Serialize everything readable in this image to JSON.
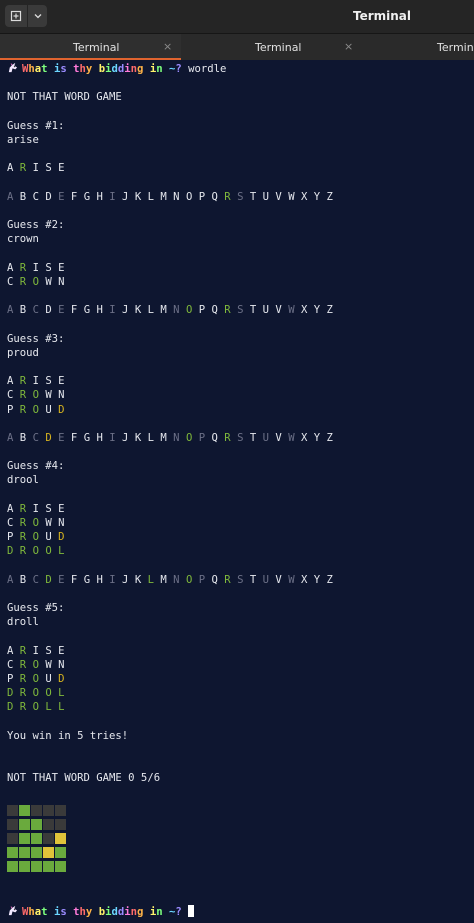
{
  "window": {
    "title": "Terminal",
    "new_tab_icon": "new-tab-icon",
    "menu_icon": "chevron-down-icon"
  },
  "tabs": [
    {
      "label": "Terminal",
      "close": "×",
      "active": true
    },
    {
      "label": "Terminal",
      "close": "×",
      "active": false
    },
    {
      "label": "Terminal",
      "close": "",
      "active": false
    }
  ],
  "prompt": {
    "text": "What is thy bidding in ~?",
    "icon": "unicorn-icon",
    "colors": [
      "#ff6b6b",
      "#ffb347",
      "#fff36b",
      "#7dff7d",
      "#6bd6ff",
      "#9b8cff",
      "#ff7ad9"
    ]
  },
  "command": "wordle",
  "banner": "NOT THAT WORD GAME",
  "colors": {
    "green": "#7fb83b",
    "yellow": "#d8b41f",
    "dim": "#6c7087",
    "default": "#e6e8ee"
  },
  "rounds": [
    {
      "guess_label": "Guess #1:",
      "guess": "arise",
      "board": [
        [
          "A",
          "d"
        ],
        [
          "R",
          "g"
        ],
        [
          "I",
          "d"
        ],
        [
          "S",
          "d"
        ],
        [
          "E",
          "d"
        ]
      ],
      "alphabet": [
        [
          "A",
          "d"
        ],
        [
          "B",
          ""
        ],
        [
          "C",
          ""
        ],
        [
          "D",
          ""
        ],
        [
          "E",
          "d"
        ],
        [
          "F",
          ""
        ],
        [
          "G",
          ""
        ],
        [
          "H",
          ""
        ],
        [
          "I",
          "d"
        ],
        [
          "J",
          ""
        ],
        [
          "K",
          ""
        ],
        [
          "L",
          ""
        ],
        [
          "M",
          ""
        ],
        [
          "N",
          ""
        ],
        [
          "O",
          ""
        ],
        [
          "P",
          ""
        ],
        [
          "Q",
          ""
        ],
        [
          "R",
          "g"
        ],
        [
          "S",
          "d"
        ],
        [
          "T",
          ""
        ],
        [
          "U",
          ""
        ],
        [
          "V",
          ""
        ],
        [
          "W",
          ""
        ],
        [
          "X",
          ""
        ],
        [
          "Y",
          ""
        ],
        [
          "Z",
          ""
        ]
      ]
    },
    {
      "guess_label": "Guess #2:",
      "guess": "crown",
      "alphabet": [
        [
          "A",
          "d"
        ],
        [
          "B",
          ""
        ],
        [
          "C",
          "d"
        ],
        [
          "D",
          ""
        ],
        [
          "E",
          "d"
        ],
        [
          "F",
          ""
        ],
        [
          "G",
          ""
        ],
        [
          "H",
          ""
        ],
        [
          "I",
          "d"
        ],
        [
          "J",
          ""
        ],
        [
          "K",
          ""
        ],
        [
          "L",
          ""
        ],
        [
          "M",
          ""
        ],
        [
          "N",
          "d"
        ],
        [
          "O",
          "g"
        ],
        [
          "P",
          ""
        ],
        [
          "Q",
          ""
        ],
        [
          "R",
          "g"
        ],
        [
          "S",
          "d"
        ],
        [
          "T",
          ""
        ],
        [
          "U",
          ""
        ],
        [
          "V",
          ""
        ],
        [
          "W",
          "d"
        ],
        [
          "X",
          ""
        ],
        [
          "Y",
          ""
        ],
        [
          "Z",
          ""
        ]
      ]
    },
    {
      "guess_label": "Guess #3:",
      "guess": "proud",
      "alphabet": [
        [
          "A",
          "d"
        ],
        [
          "B",
          ""
        ],
        [
          "C",
          "d"
        ],
        [
          "D",
          "y"
        ],
        [
          "E",
          "d"
        ],
        [
          "F",
          ""
        ],
        [
          "G",
          ""
        ],
        [
          "H",
          ""
        ],
        [
          "I",
          "d"
        ],
        [
          "J",
          ""
        ],
        [
          "K",
          ""
        ],
        [
          "L",
          ""
        ],
        [
          "M",
          ""
        ],
        [
          "N",
          "d"
        ],
        [
          "O",
          "g"
        ],
        [
          "P",
          "d"
        ],
        [
          "Q",
          ""
        ],
        [
          "R",
          "g"
        ],
        [
          "S",
          "d"
        ],
        [
          "T",
          ""
        ],
        [
          "U",
          "d"
        ],
        [
          "V",
          ""
        ],
        [
          "W",
          "d"
        ],
        [
          "X",
          ""
        ],
        [
          "Y",
          ""
        ],
        [
          "Z",
          ""
        ]
      ]
    },
    {
      "guess_label": "Guess #4:",
      "guess": "drool",
      "alphabet": [
        [
          "A",
          "d"
        ],
        [
          "B",
          ""
        ],
        [
          "C",
          "d"
        ],
        [
          "D",
          "g"
        ],
        [
          "E",
          "d"
        ],
        [
          "F",
          ""
        ],
        [
          "G",
          ""
        ],
        [
          "H",
          ""
        ],
        [
          "I",
          "d"
        ],
        [
          "J",
          ""
        ],
        [
          "K",
          ""
        ],
        [
          "L",
          "g"
        ],
        [
          "M",
          ""
        ],
        [
          "N",
          "d"
        ],
        [
          "O",
          "g"
        ],
        [
          "P",
          "d"
        ],
        [
          "Q",
          ""
        ],
        [
          "R",
          "g"
        ],
        [
          "S",
          "d"
        ],
        [
          "T",
          ""
        ],
        [
          "U",
          "d"
        ],
        [
          "V",
          ""
        ],
        [
          "W",
          "d"
        ],
        [
          "X",
          ""
        ],
        [
          "Y",
          ""
        ],
        [
          "Z",
          ""
        ]
      ]
    },
    {
      "guess_label": "Guess #5:",
      "guess": "droll",
      "alphabet": null
    }
  ],
  "board_rows": [
    [
      [
        "A",
        ""
      ],
      [
        "R",
        "g"
      ],
      [
        "I",
        ""
      ],
      [
        "S",
        ""
      ],
      [
        "E",
        ""
      ]
    ],
    [
      [
        "C",
        ""
      ],
      [
        "R",
        "g"
      ],
      [
        "O",
        "g"
      ],
      [
        "W",
        ""
      ],
      [
        "N",
        ""
      ]
    ],
    [
      [
        "P",
        ""
      ],
      [
        "R",
        "g"
      ],
      [
        "O",
        "g"
      ],
      [
        "U",
        ""
      ],
      [
        "D",
        "y"
      ]
    ],
    [
      [
        "D",
        "g"
      ],
      [
        "R",
        "g"
      ],
      [
        "O",
        "g"
      ],
      [
        "O",
        "g"
      ],
      [
        "L",
        "g"
      ]
    ],
    [
      [
        "D",
        "g"
      ],
      [
        "R",
        "g"
      ],
      [
        "O",
        "g"
      ],
      [
        "L",
        "g"
      ],
      [
        "L",
        "g"
      ]
    ]
  ],
  "win_message": "You win in 5 tries!",
  "summary": "NOT THAT WORD GAME 0 5/6",
  "share_grid": [
    [
      "gray",
      "green",
      "gray",
      "gray",
      "gray"
    ],
    [
      "gray",
      "green",
      "green",
      "gray",
      "gray"
    ],
    [
      "gray",
      "green",
      "green",
      "gray",
      "yellow"
    ],
    [
      "green",
      "green",
      "green",
      "yellow",
      "green"
    ],
    [
      "green",
      "green",
      "green",
      "green",
      "green"
    ]
  ]
}
